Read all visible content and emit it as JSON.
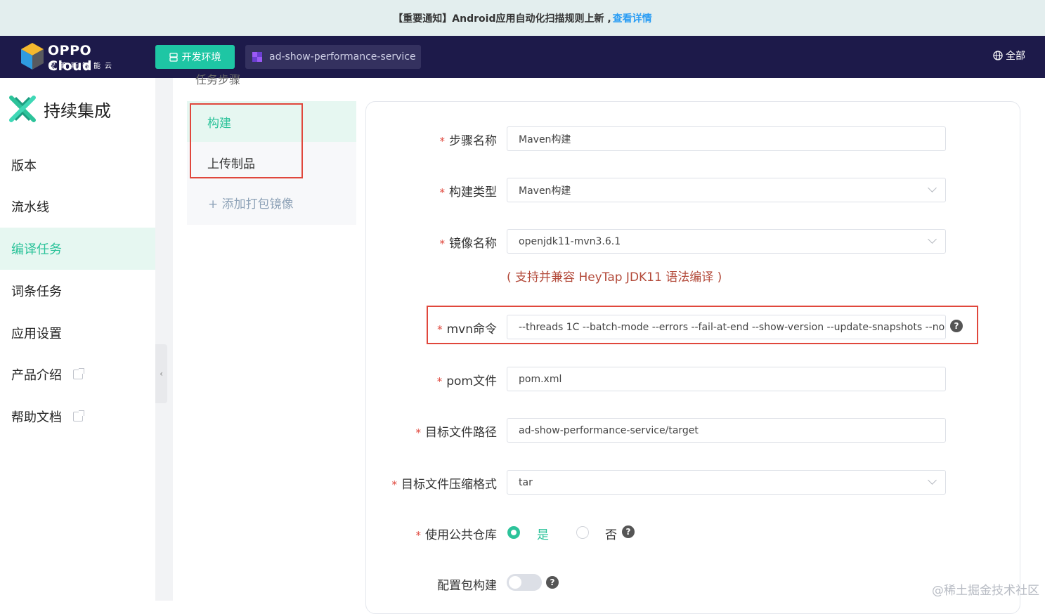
{
  "notice": {
    "text": "【重要通知】Android应用自动化扫描规则上新 ,",
    "link": "查看详情"
  },
  "header": {
    "brand": "OPPO Cloud",
    "brand_sub": "安第斯智能云",
    "env_button": "开发环境",
    "service": "ad-show-performance-service",
    "all": "全部"
  },
  "sidebar": {
    "title": "持续集成",
    "items": [
      {
        "label": "版本"
      },
      {
        "label": "流水线"
      },
      {
        "label": "编译任务"
      },
      {
        "label": "词条任务"
      },
      {
        "label": "应用设置"
      },
      {
        "label": "产品介绍"
      },
      {
        "label": "帮助文档"
      }
    ]
  },
  "steps": {
    "heading": "任务步骤",
    "items": [
      {
        "label": "构建"
      },
      {
        "label": "上传制品"
      }
    ],
    "add": "+ 添加打包镜像"
  },
  "form": {
    "step_name": {
      "label": "步骤名称",
      "value": "Maven构建"
    },
    "build_type": {
      "label": "构建类型",
      "value": "Maven构建"
    },
    "image_name": {
      "label": "镜像名称",
      "value": "openjdk11-mvn3.6.1"
    },
    "image_hint": "( 支持并兼容 HeyTap JDK11 语法编译 )",
    "mvn_cmd": {
      "label": "mvn命令",
      "value": "--threads 1C --batch-mode --errors --fail-at-end --show-version --update-snapshots --no-tr"
    },
    "pom": {
      "label": "pom文件",
      "value": "pom.xml"
    },
    "target_path": {
      "label": "目标文件路径",
      "value": "ad-show-performance-service/target"
    },
    "compress": {
      "label": "目标文件压缩格式",
      "value": "tar"
    },
    "public_repo": {
      "label": "使用公共仓库",
      "yes": "是",
      "no": "否",
      "selected": "是"
    },
    "config_build": {
      "label": "配置包构建",
      "enabled": false
    }
  },
  "watermark": "@稀土掘金技术社区",
  "colors": {
    "accent": "#2cc39a",
    "header_bg": "#1d1a4a",
    "highlight_border": "#e0473c"
  }
}
